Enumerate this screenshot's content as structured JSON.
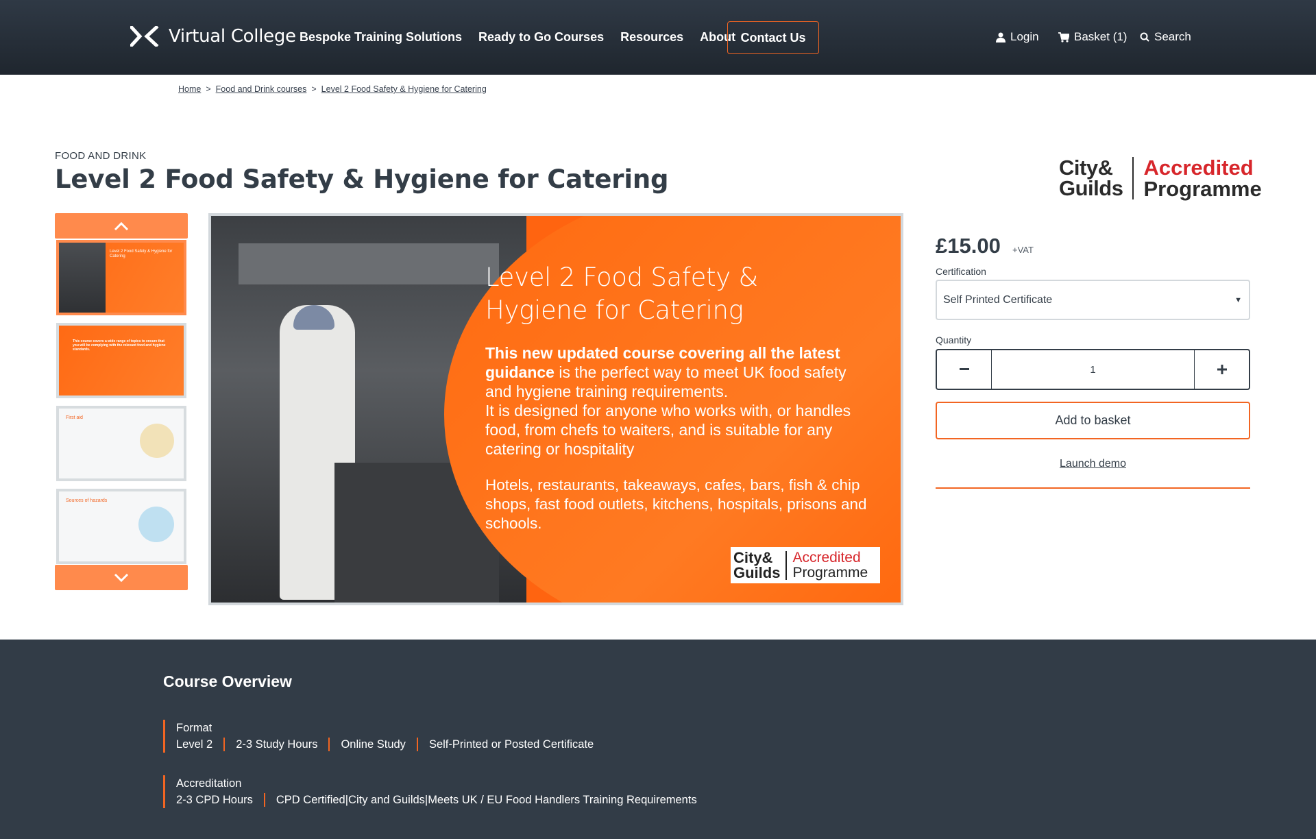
{
  "header": {
    "logo_text": "Virtual College",
    "nav": [
      "Bespoke Training Solutions",
      "Ready to Go Courses",
      "Resources",
      "About"
    ],
    "contact_label": "Contact Us",
    "login_label": "Login",
    "basket_label": "Basket (1)",
    "search_label": "Search",
    "accent_color": "#f26522"
  },
  "breadcrumb": [
    "Home",
    "Food and Drink courses",
    "Level 2 Food Safety & Hygiene for Catering"
  ],
  "product": {
    "category": "FOOD AND DRINK",
    "title": "Level 2 Food Safety & Hygiene for Catering",
    "accreditation_logo": {
      "line1": "City&",
      "line2": "Guilds",
      "acc": "Accredited",
      "prog": "Programme"
    }
  },
  "gallery": {
    "main": {
      "title": "Level 2 Food Safety & Hygiene for Catering",
      "body_bold": "This new updated course covering all the latest guidance",
      "body_rest": " is the perfect way to meet UK food safety and hygiene training requirements.",
      "body_2": "It is designed for anyone who works with, or handles food, from chefs to waiters, and is suitable for any catering or hospitality",
      "sub": "Hotels, restaurants, takeaways, cafes, bars, fish & chip shops, fast food outlets, kitchens, hospitals, prisons and schools."
    },
    "thumbs": [
      {
        "title": "Level 2 Food Safety & Hygiene for Catering"
      },
      {
        "title": "This course covers a wide range of topics to ensure that you will be complying with the relevant food and hygiene standards."
      },
      {
        "title": "First aid"
      },
      {
        "title": "Sources of hazards"
      }
    ]
  },
  "purchase": {
    "price": "£15.00",
    "vat": "+VAT",
    "certification_label": "Certification",
    "certification_value": "Self Printed Certificate",
    "quantity_label": "Quantity",
    "quantity_value": "1",
    "add_label": "Add to basket",
    "demo_label": "Launch demo"
  },
  "overview": {
    "title": "Course Overview",
    "format": {
      "head": "Format",
      "items": [
        "Level 2",
        "2-3 Study Hours",
        "Online Study",
        "Self-Printed or Posted Certificate"
      ]
    },
    "accreditation": {
      "head": "Accreditation",
      "items": [
        "2-3 CPD Hours",
        "CPD Certified|City and Guilds|Meets UK / EU Food Handlers Training Requirements"
      ]
    }
  }
}
